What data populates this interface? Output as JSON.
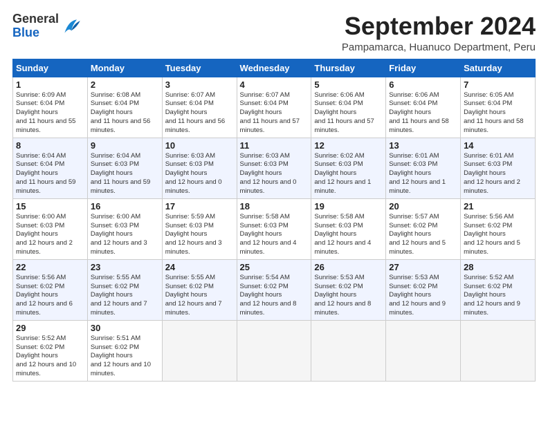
{
  "logo": {
    "general": "General",
    "blue": "Blue"
  },
  "title": "September 2024",
  "subtitle": "Pampamarca, Huanuco Department, Peru",
  "days_of_week": [
    "Sunday",
    "Monday",
    "Tuesday",
    "Wednesday",
    "Thursday",
    "Friday",
    "Saturday"
  ],
  "weeks": [
    [
      {
        "day": "1",
        "rise": "6:09 AM",
        "set": "6:04 PM",
        "daylight": "11 hours and 55 minutes."
      },
      {
        "day": "2",
        "rise": "6:08 AM",
        "set": "6:04 PM",
        "daylight": "11 hours and 56 minutes."
      },
      {
        "day": "3",
        "rise": "6:07 AM",
        "set": "6:04 PM",
        "daylight": "11 hours and 56 minutes."
      },
      {
        "day": "4",
        "rise": "6:07 AM",
        "set": "6:04 PM",
        "daylight": "11 hours and 57 minutes."
      },
      {
        "day": "5",
        "rise": "6:06 AM",
        "set": "6:04 PM",
        "daylight": "11 hours and 57 minutes."
      },
      {
        "day": "6",
        "rise": "6:06 AM",
        "set": "6:04 PM",
        "daylight": "11 hours and 58 minutes."
      },
      {
        "day": "7",
        "rise": "6:05 AM",
        "set": "6:04 PM",
        "daylight": "11 hours and 58 minutes."
      }
    ],
    [
      {
        "day": "8",
        "rise": "6:04 AM",
        "set": "6:04 PM",
        "daylight": "11 hours and 59 minutes."
      },
      {
        "day": "9",
        "rise": "6:04 AM",
        "set": "6:03 PM",
        "daylight": "11 hours and 59 minutes."
      },
      {
        "day": "10",
        "rise": "6:03 AM",
        "set": "6:03 PM",
        "daylight": "12 hours and 0 minutes."
      },
      {
        "day": "11",
        "rise": "6:03 AM",
        "set": "6:03 PM",
        "daylight": "12 hours and 0 minutes."
      },
      {
        "day": "12",
        "rise": "6:02 AM",
        "set": "6:03 PM",
        "daylight": "12 hours and 1 minute."
      },
      {
        "day": "13",
        "rise": "6:01 AM",
        "set": "6:03 PM",
        "daylight": "12 hours and 1 minute."
      },
      {
        "day": "14",
        "rise": "6:01 AM",
        "set": "6:03 PM",
        "daylight": "12 hours and 2 minutes."
      }
    ],
    [
      {
        "day": "15",
        "rise": "6:00 AM",
        "set": "6:03 PM",
        "daylight": "12 hours and 2 minutes."
      },
      {
        "day": "16",
        "rise": "6:00 AM",
        "set": "6:03 PM",
        "daylight": "12 hours and 3 minutes."
      },
      {
        "day": "17",
        "rise": "5:59 AM",
        "set": "6:03 PM",
        "daylight": "12 hours and 3 minutes."
      },
      {
        "day": "18",
        "rise": "5:58 AM",
        "set": "6:03 PM",
        "daylight": "12 hours and 4 minutes."
      },
      {
        "day": "19",
        "rise": "5:58 AM",
        "set": "6:03 PM",
        "daylight": "12 hours and 4 minutes."
      },
      {
        "day": "20",
        "rise": "5:57 AM",
        "set": "6:02 PM",
        "daylight": "12 hours and 5 minutes."
      },
      {
        "day": "21",
        "rise": "5:56 AM",
        "set": "6:02 PM",
        "daylight": "12 hours and 5 minutes."
      }
    ],
    [
      {
        "day": "22",
        "rise": "5:56 AM",
        "set": "6:02 PM",
        "daylight": "12 hours and 6 minutes."
      },
      {
        "day": "23",
        "rise": "5:55 AM",
        "set": "6:02 PM",
        "daylight": "12 hours and 7 minutes."
      },
      {
        "day": "24",
        "rise": "5:55 AM",
        "set": "6:02 PM",
        "daylight": "12 hours and 7 minutes."
      },
      {
        "day": "25",
        "rise": "5:54 AM",
        "set": "6:02 PM",
        "daylight": "12 hours and 8 minutes."
      },
      {
        "day": "26",
        "rise": "5:53 AM",
        "set": "6:02 PM",
        "daylight": "12 hours and 8 minutes."
      },
      {
        "day": "27",
        "rise": "5:53 AM",
        "set": "6:02 PM",
        "daylight": "12 hours and 9 minutes."
      },
      {
        "day": "28",
        "rise": "5:52 AM",
        "set": "6:02 PM",
        "daylight": "12 hours and 9 minutes."
      }
    ],
    [
      {
        "day": "29",
        "rise": "5:52 AM",
        "set": "6:02 PM",
        "daylight": "12 hours and 10 minutes."
      },
      {
        "day": "30",
        "rise": "5:51 AM",
        "set": "6:02 PM",
        "daylight": "12 hours and 10 minutes."
      },
      null,
      null,
      null,
      null,
      null
    ]
  ]
}
